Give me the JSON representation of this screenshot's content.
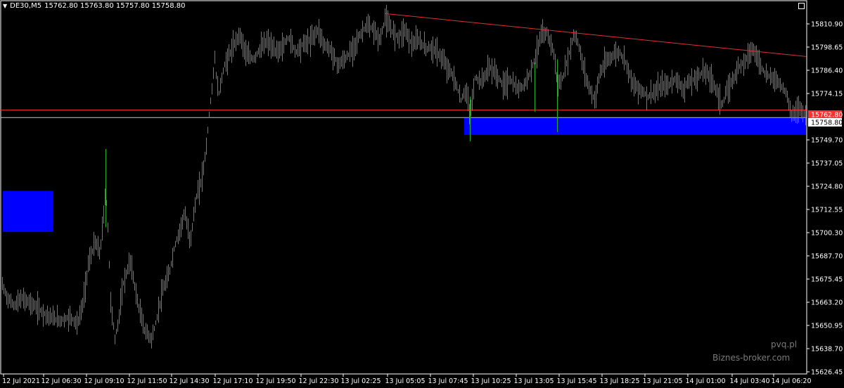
{
  "header": {
    "symbol": "DE30,M5",
    "ohlc": "15762.80 15763.80 15757.80 15758.80",
    "menu_icon": "triangle-down-icon"
  },
  "watermark": {
    "line1": "pvq.pl",
    "line2": "Biznes-broker.com"
  },
  "colors": {
    "background": "#000000",
    "candles": "#1fb41f",
    "axis": "#ffffff",
    "trendline": "#e03030",
    "bid_line": "#ff3030",
    "last_line": "#c8c8c8",
    "zone": "#0000ff"
  },
  "chart_data": {
    "type": "candlestick",
    "symbol": "DE30",
    "timeframe": "M5",
    "y_ticks": [
      "15810.90",
      "15798.65",
      "15786.40",
      "15774.15",
      "15762.80",
      "15758.80",
      "15749.70",
      "15737.05",
      "15724.80",
      "15712.55",
      "15700.30",
      "15687.70",
      "15675.45",
      "15663.20",
      "15650.95",
      "15638.70",
      "15626.45"
    ],
    "x_ticks": [
      "12 Jul 2021",
      "12 Jul 06:30",
      "12 Jul 09:10",
      "12 Jul 11:50",
      "12 Jul 14:30",
      "12 Jul 17:10",
      "12 Jul 19:50",
      "12 Jul 22:30",
      "13 Jul 02:25",
      "13 Jul 05:05",
      "13 Jul 07:45",
      "13 Jul 10:25",
      "13 Jul 13:05",
      "13 Jul 15:45",
      "13 Jul 18:25",
      "13 Jul 21:05",
      "14 Jul 01:00",
      "14 Jul 03:40",
      "14 Jul 06:20"
    ],
    "price_labels": {
      "bid": "15762.80",
      "last": "15758.80"
    },
    "levels": {
      "bid": 15762.8,
      "last": 15758.8
    },
    "trendline": {
      "from": [
        "13 Jul 02:25",
        15814.5
      ],
      "to": [
        "14 Jul 06:20",
        15791.5
      ]
    },
    "zones": [
      {
        "name": "support-zone",
        "from": "13 Jul 07:45",
        "to": "14 Jul 06:20",
        "high": 15758.5,
        "low": 15749.5
      },
      {
        "name": "left-zone",
        "from": "12 Jul 2021",
        "to": "12 Jul 06:30",
        "high": 15719.5,
        "low": 15697.5
      }
    ],
    "price_path": [
      [
        0,
        15672
      ],
      [
        4,
        15668
      ],
      [
        10,
        15662
      ],
      [
        20,
        15658
      ],
      [
        30,
        15662
      ],
      [
        40,
        15660
      ],
      [
        55,
        15656
      ],
      [
        70,
        15652
      ],
      [
        85,
        15650
      ],
      [
        100,
        15652
      ],
      [
        110,
        15648
      ],
      [
        118,
        15660
      ],
      [
        125,
        15680
      ],
      [
        135,
        15692
      ],
      [
        142,
        15686
      ],
      [
        150,
        15720
      ],
      [
        153,
        15700
      ],
      [
        157,
        15660
      ],
      [
        163,
        15640
      ],
      [
        168,
        15650
      ],
      [
        175,
        15670
      ],
      [
        185,
        15682
      ],
      [
        195,
        15660
      ],
      [
        205,
        15645
      ],
      [
        215,
        15640
      ],
      [
        222,
        15650
      ],
      [
        230,
        15665
      ],
      [
        240,
        15675
      ],
      [
        248,
        15690
      ],
      [
        255,
        15698
      ],
      [
        262,
        15708
      ],
      [
        270,
        15692
      ],
      [
        278,
        15715
      ],
      [
        286,
        15725
      ],
      [
        292,
        15740
      ],
      [
        297,
        15760
      ],
      [
        301,
        15775
      ],
      [
        305,
        15790
      ],
      [
        310,
        15770
      ],
      [
        318,
        15786
      ],
      [
        325,
        15792
      ],
      [
        333,
        15798
      ],
      [
        340,
        15804
      ],
      [
        350,
        15792
      ],
      [
        360,
        15790
      ],
      [
        370,
        15796
      ],
      [
        380,
        15800
      ],
      [
        390,
        15794
      ],
      [
        400,
        15796
      ],
      [
        410,
        15802
      ],
      [
        420,
        15794
      ],
      [
        430,
        15798
      ],
      [
        440,
        15800
      ],
      [
        452,
        15806
      ],
      [
        460,
        15798
      ],
      [
        470,
        15795
      ],
      [
        480,
        15787
      ],
      [
        490,
        15790
      ],
      [
        500,
        15795
      ],
      [
        510,
        15802
      ],
      [
        520,
        15808
      ],
      [
        530,
        15806
      ],
      [
        540,
        15800
      ],
      [
        547,
        15812
      ],
      [
        555,
        15806
      ],
      [
        565,
        15802
      ],
      [
        575,
        15806
      ],
      [
        585,
        15798
      ],
      [
        595,
        15800
      ],
      [
        605,
        15796
      ],
      [
        615,
        15796
      ],
      [
        625,
        15792
      ],
      [
        635,
        15786
      ],
      [
        645,
        15780
      ],
      [
        655,
        15768
      ],
      [
        662,
        15774
      ],
      [
        668,
        15760
      ],
      [
        675,
        15780
      ],
      [
        685,
        15778
      ],
      [
        695,
        15786
      ],
      [
        705,
        15782
      ],
      [
        715,
        15776
      ],
      [
        725,
        15779
      ],
      [
        735,
        15774
      ],
      [
        745,
        15776
      ],
      [
        752,
        15782
      ],
      [
        760,
        15790
      ],
      [
        768,
        15802
      ],
      [
        778,
        15804
      ],
      [
        786,
        15795
      ],
      [
        793,
        15776
      ],
      [
        800,
        15780
      ],
      [
        808,
        15792
      ],
      [
        816,
        15804
      ],
      [
        822,
        15798
      ],
      [
        830,
        15784
      ],
      [
        838,
        15774
      ],
      [
        845,
        15768
      ],
      [
        852,
        15782
      ],
      [
        860,
        15788
      ],
      [
        870,
        15792
      ],
      [
        880,
        15794
      ],
      [
        890,
        15788
      ],
      [
        900,
        15776
      ],
      [
        910,
        15774
      ],
      [
        920,
        15770
      ],
      [
        930,
        15772
      ],
      [
        940,
        15776
      ],
      [
        950,
        15776
      ],
      [
        960,
        15780
      ],
      [
        970,
        15774
      ],
      [
        980,
        15778
      ],
      [
        990,
        15780
      ],
      [
        1000,
        15784
      ],
      [
        1010,
        15780
      ],
      [
        1020,
        15772
      ],
      [
        1026,
        15765
      ],
      [
        1032,
        15772
      ],
      [
        1040,
        15778
      ],
      [
        1050,
        15786
      ],
      [
        1060,
        15790
      ],
      [
        1068,
        15796
      ],
      [
        1075,
        15792
      ],
      [
        1082,
        15786
      ],
      [
        1090,
        15781
      ],
      [
        1100,
        15780
      ],
      [
        1110,
        15776
      ],
      [
        1118,
        15772
      ],
      [
        1124,
        15760
      ],
      [
        1130,
        15762
      ],
      [
        1138,
        15764
      ],
      [
        1145,
        15760
      ]
    ]
  }
}
